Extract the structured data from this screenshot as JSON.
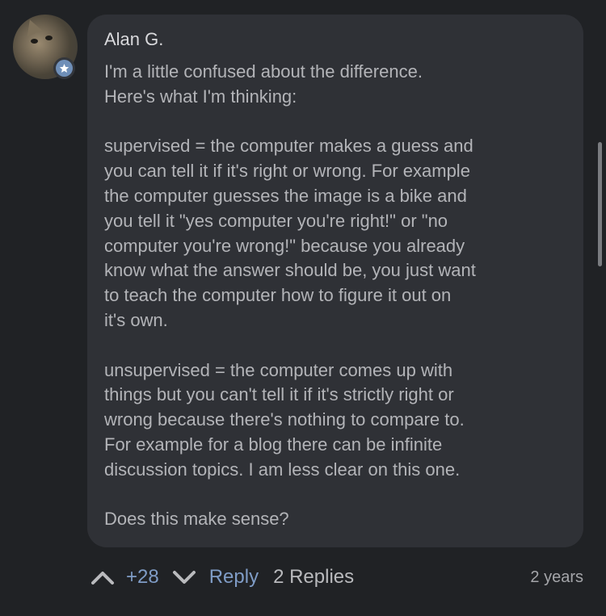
{
  "comment": {
    "author": "Alan G.",
    "avatar_badge_icon": "star-icon",
    "paragraphs": [
      "I'm a little confused about the difference.\nHere's what I'm thinking:",
      "supervised = the computer makes a guess and\nyou can tell it if it's right or wrong. For example\nthe computer guesses the image is a bike and\nyou tell it \"yes computer you're right!\" or \"no\ncomputer you're wrong!\" because you already\nknow what the answer should be, you just want\nto teach the computer how to figure it out on\nit's own.",
      "unsupervised = the computer comes up with\nthings but you can't tell it if it's strictly right or\nwrong because there's nothing to compare to.\nFor example for a blog there can be infinite\ndiscussion topics. I am less clear on this one.",
      "Does this make sense?"
    ]
  },
  "actions": {
    "upvote_icon": "chevron-up-icon",
    "score": "+28",
    "downvote_icon": "chevron-down-icon",
    "reply_label": "Reply",
    "replies_label": "2 Replies",
    "time_ago": "2 years"
  },
  "colors": {
    "background": "#202225",
    "bubble": "#2f3136",
    "accent": "#7f9cc6",
    "text": "#b3b4b8"
  }
}
